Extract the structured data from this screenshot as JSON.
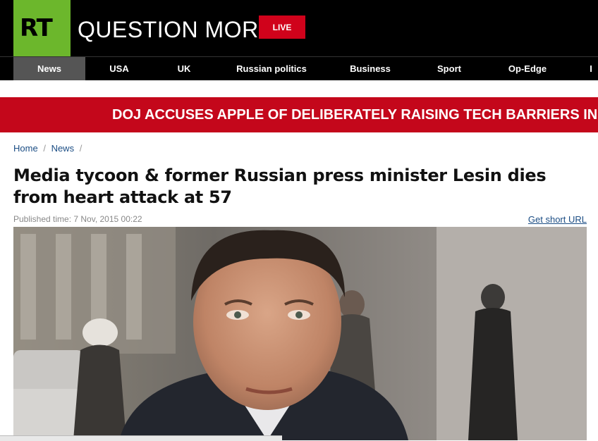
{
  "header": {
    "logo_text": "RT",
    "tagline": "QUESTION MORE",
    "live_label": "LIVE"
  },
  "nav": {
    "items": [
      {
        "label": "News",
        "active": true
      },
      {
        "label": "USA"
      },
      {
        "label": "UK"
      },
      {
        "label": "Russian politics"
      },
      {
        "label": "Business"
      },
      {
        "label": "Sport"
      },
      {
        "label": "Op-Edge"
      },
      {
        "label": "I"
      }
    ]
  },
  "ticker": {
    "text": "DOJ ACCUSES APPLE OF DELIBERATELY RAISING TECH BARRIERS IN SAN"
  },
  "breadcrumb": {
    "items": [
      "Home",
      "News"
    ],
    "separator": "/"
  },
  "article": {
    "title": "Media tycoon & former Russian press minister Lesin dies from heart attack at 57",
    "published": "Published time: 7 Nov, 2015 00:22",
    "short_url_label": "Get short URL"
  },
  "colors": {
    "brand_green": "#6cb72c",
    "live_red": "#d0021b",
    "ticker_red": "#c4071b",
    "link_blue": "#1b4d84"
  }
}
